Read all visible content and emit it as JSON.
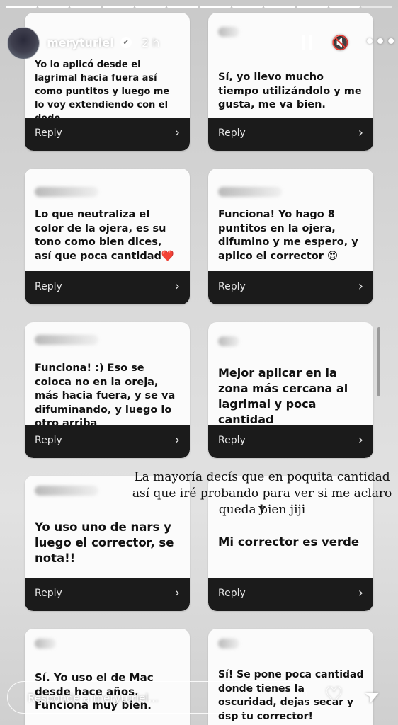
{
  "header": {
    "username": "meryturiel",
    "time": "2 h",
    "verified_icon": "✔",
    "pause_icon": "pause-icon",
    "mute_icon": "🔇",
    "more_icon": "•••"
  },
  "reply_label": "Reply",
  "chevron": "›",
  "cards": [
    {
      "text": "Yo lo aplicó desde el lagrimal hacia fuera así como puntitos y luego me lo voy extendiendo con el dedo."
    },
    {
      "text": "Sí, yo llevo mucho tiempo utilizándolo y me gusta, me va bien."
    },
    {
      "text": "Lo que neutraliza el color de la ojera, es su tono como bien dices, así que poca cantidad❤️"
    },
    {
      "text": "Funciona! Yo hago 8 puntitos en la ojera, difumino y me espero, y aplico el corrector 😍"
    },
    {
      "text": "Funciona! :) Eso se coloca no en la oreja, más hacia fuera, y se va difuminando, y luego lo otro arriba"
    },
    {
      "text": "Mejor aplicar en la zona más cercana al lagrimal y poca cantidad"
    },
    {
      "text": "Yo uso uno de nars y luego el corrector, se nota!!"
    },
    {
      "text": "Mi corrector es verde"
    },
    {
      "text": "Sí. Yo uso el de Mac desde hace años. Funciona muy bien."
    },
    {
      "text": "Sí! Se pone poca cantidad donde tienes la oscuridad, dejas secar y dsp tu corrector!"
    }
  ],
  "overlay_text": {
    "line1": "La mayoría decís que en poquita cantidad",
    "line2": "así que iré probando para ver si me aclaro y",
    "line3": "queda bien jiji"
  },
  "footer": {
    "placeholder": "Responde a meryturiel...",
    "heart_icon": "♡",
    "send_icon": "➤"
  }
}
